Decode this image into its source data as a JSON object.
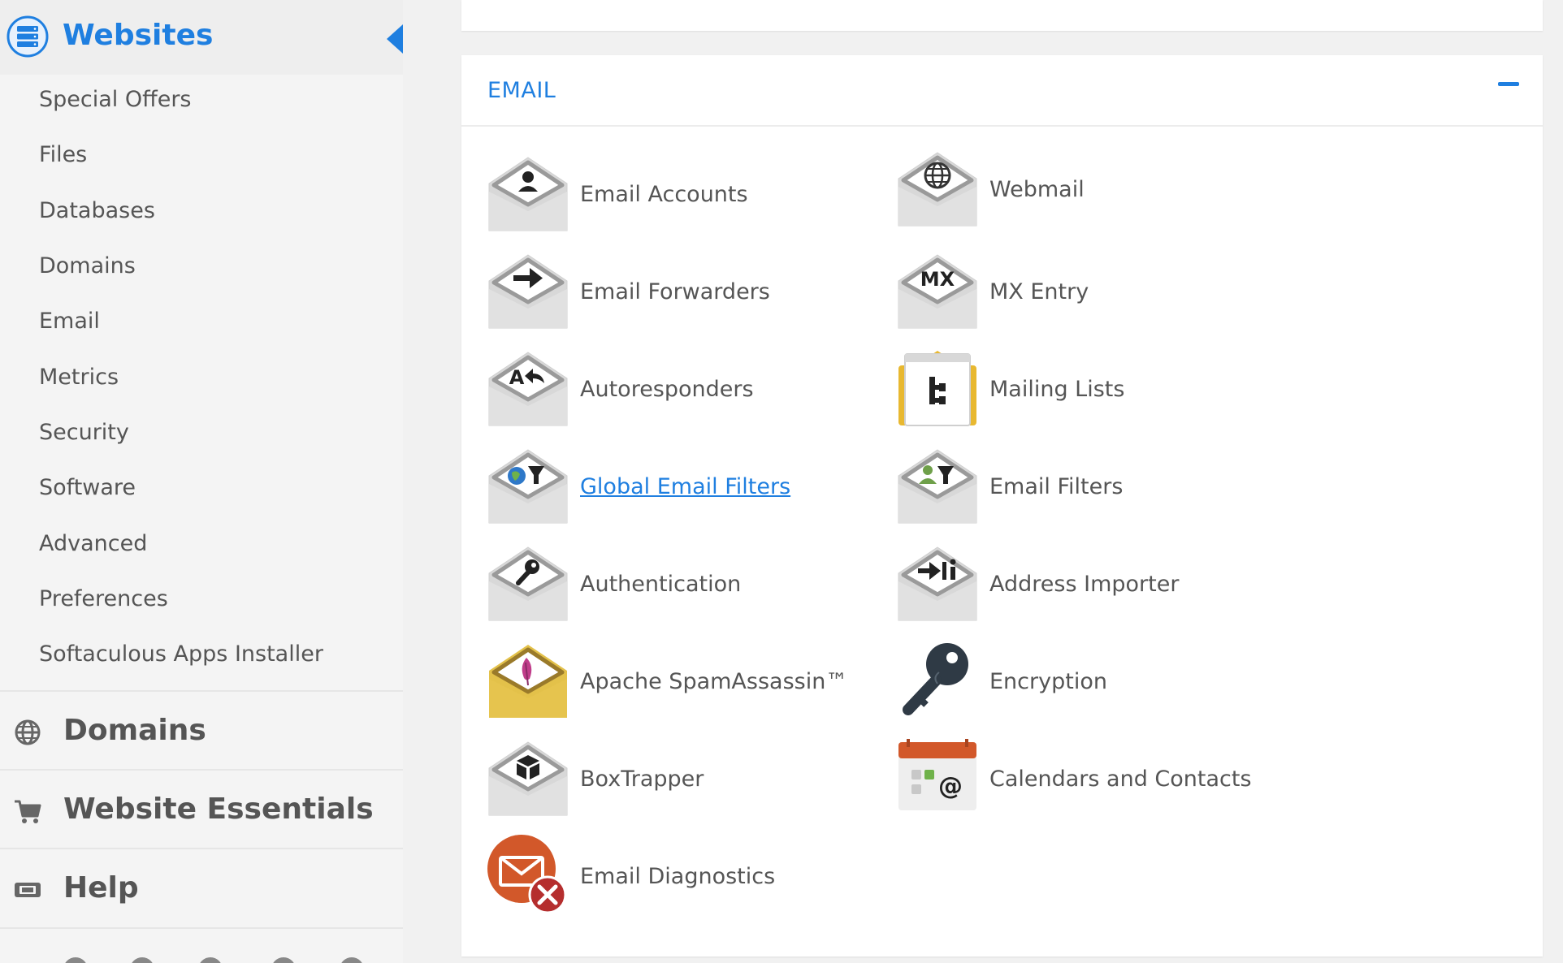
{
  "colors": {
    "accent": "#1f7fe0",
    "text": "#555555",
    "sidebar_bg": "#f4f4f4",
    "page_bg": "#f1f1f1"
  },
  "sidebar": {
    "title": "Websites",
    "title_icon": "server-icon",
    "collapse_icon": "triangle-left-icon",
    "items": [
      {
        "label": "Special Offers"
      },
      {
        "label": "Files"
      },
      {
        "label": "Databases"
      },
      {
        "label": "Domains"
      },
      {
        "label": "Email"
      },
      {
        "label": "Metrics"
      },
      {
        "label": "Security"
      },
      {
        "label": "Software"
      },
      {
        "label": "Advanced"
      },
      {
        "label": "Preferences"
      },
      {
        "label": "Softaculous Apps Installer"
      }
    ],
    "sections": [
      {
        "label": "Domains",
        "icon": "globe-icon"
      },
      {
        "label": "Website Essentials",
        "icon": "cart-icon"
      },
      {
        "label": "Help",
        "icon": "ticket-icon"
      }
    ]
  },
  "email_panel": {
    "title": "EMAIL",
    "toggle_icon": "minus-icon",
    "tools": [
      {
        "label": "Email Accounts",
        "icon": "email-accounts-icon"
      },
      {
        "label": "Webmail",
        "icon": "webmail-globe-icon"
      },
      {
        "label": "Email Forwarders",
        "icon": "email-forwarders-icon"
      },
      {
        "label": "MX Entry",
        "icon": "mx-entry-icon"
      },
      {
        "label": "Autoresponders",
        "icon": "autoresponders-icon"
      },
      {
        "label": "Mailing Lists",
        "icon": "mailing-lists-icon"
      },
      {
        "label": "Global Email Filters",
        "icon": "global-email-filters-icon"
      },
      {
        "label": "Email Filters",
        "icon": "email-filters-icon"
      },
      {
        "label": "Authentication",
        "icon": "authentication-key-icon"
      },
      {
        "label": "Address Importer",
        "icon": "address-importer-icon"
      },
      {
        "label": "Apache SpamAssassin™",
        "icon": "spamassassin-feather-icon"
      },
      {
        "label": "Encryption",
        "icon": "encryption-key-icon"
      },
      {
        "label": "BoxTrapper",
        "icon": "boxtrapper-icon"
      },
      {
        "label": "Calendars and Contacts",
        "icon": "calendar-icon"
      },
      {
        "label": "Email Diagnostics",
        "icon": "email-diagnostics-icon"
      }
    ]
  }
}
